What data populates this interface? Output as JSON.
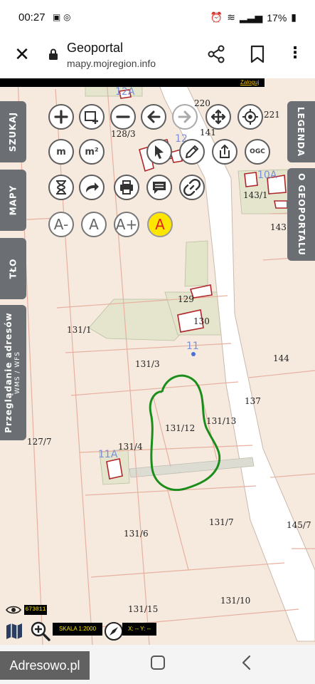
{
  "status_bar": {
    "time": "00:27",
    "battery": "17%"
  },
  "browser": {
    "title": "Geoportal",
    "url": "mapy.mojregion.info"
  },
  "map": {
    "logout_link": "Zaloguj",
    "parcels": [
      "128/3",
      "220",
      "141",
      "221",
      "143/1",
      "143",
      "129",
      "130",
      "131/1",
      "131/3",
      "144",
      "137",
      "131/12",
      "131/13",
      "127/7",
      "131/4",
      "131/7",
      "145/7",
      "131/6",
      "131/10",
      "131/15"
    ],
    "addresses": [
      "12A",
      "12",
      "10A",
      "11",
      "11A"
    ],
    "left_tabs": {
      "search": "SZUKAJ",
      "maps": "MAPY",
      "background": "TŁO",
      "browse_addresses": "Przeglądanie adresów",
      "browse_sub": "WMS / WFS"
    },
    "right_tabs": {
      "legend": "LEGENDA",
      "about": "O GEOPORTALU"
    },
    "toolbar": {
      "measure_length": "m",
      "measure_area": "m²",
      "ogc": "OGC",
      "font_smaller": "A-",
      "font_normal": "A",
      "font_larger": "A+",
      "font_active": "A"
    },
    "bottom": {
      "coord_value": "673011",
      "scale": "SKALA 1:2000",
      "xy": "X: --  Y: --"
    }
  },
  "watermark": "Adresowo.pl"
}
